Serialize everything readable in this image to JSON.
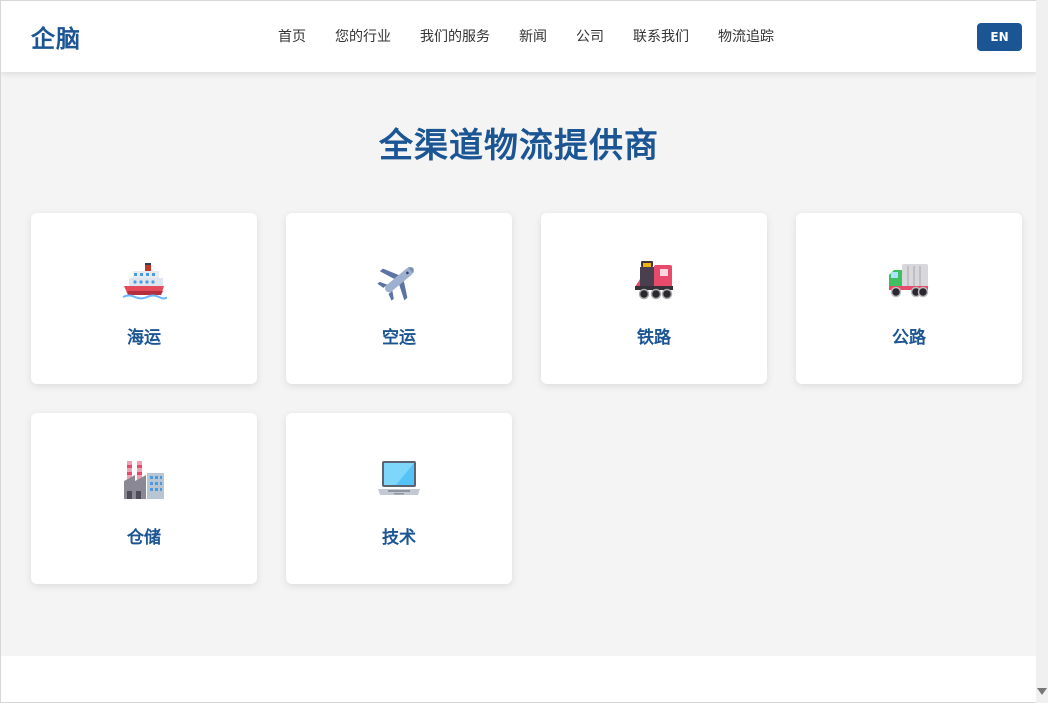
{
  "header": {
    "logo": "企脑",
    "nav": [
      "首页",
      "您的行业",
      "我们的服务",
      "新闻",
      "公司",
      "联系我们",
      "物流追踪"
    ],
    "lang_button": "EN"
  },
  "hero": {
    "title": "全渠道物流提供商"
  },
  "services": [
    {
      "label": "海运",
      "icon": "ship-icon"
    },
    {
      "label": "空运",
      "icon": "airplane-icon"
    },
    {
      "label": "铁路",
      "icon": "locomotive-icon"
    },
    {
      "label": "公路",
      "icon": "truck-icon"
    },
    {
      "label": "仓储",
      "icon": "factory-icon"
    },
    {
      "label": "技术",
      "icon": "laptop-icon"
    }
  ],
  "colors": {
    "brand": "#1b5593",
    "background": "#f4f4f4"
  }
}
